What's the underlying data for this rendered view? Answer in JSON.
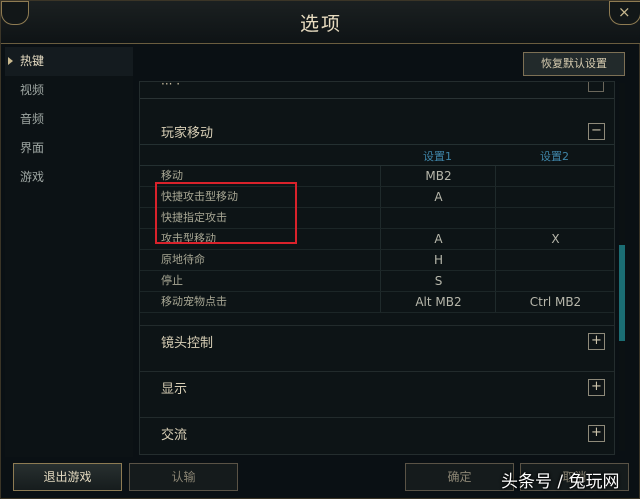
{
  "window": {
    "title": "选项",
    "close_glyph": "×"
  },
  "sidebar": {
    "items": [
      {
        "label": "热键",
        "active": true
      },
      {
        "label": "视频",
        "active": false
      },
      {
        "label": "音频",
        "active": false
      },
      {
        "label": "界面",
        "active": false
      },
      {
        "label": "游戏",
        "active": false
      }
    ]
  },
  "toolbar": {
    "restore_label": "恢复默认设置"
  },
  "sections": {
    "player_move": {
      "title": "玩家移动",
      "toggle": "−"
    },
    "camera": {
      "title": "镜头控制",
      "toggle": "+"
    },
    "display": {
      "title": "显示",
      "toggle": "+"
    },
    "chat": {
      "title": "交流",
      "toggle": "+"
    }
  },
  "grid": {
    "headers": {
      "setting1": "设置1",
      "setting2": "设置2"
    },
    "rows": [
      {
        "name": "移动",
        "b1": "MB2",
        "b2": ""
      },
      {
        "name": "快捷攻击型移动",
        "b1": "A",
        "b2": ""
      },
      {
        "name": "快捷指定攻击",
        "b1": "",
        "b2": ""
      },
      {
        "name": "攻击型移动",
        "b1": "A",
        "b2": "X"
      },
      {
        "name": "原地待命",
        "b1": "H",
        "b2": ""
      },
      {
        "name": "停止",
        "b1": "S",
        "b2": ""
      },
      {
        "name": "移动宠物点击",
        "b1": "Alt  MB2",
        "b2": "Ctrl  MB2"
      }
    ]
  },
  "footer": {
    "exit_label": "退出游戏",
    "confirm_label": "认输",
    "ok_label": "确定",
    "cancel_label": "取消"
  },
  "watermark": {
    "text": "头条号 / 兔玩网"
  },
  "colors": {
    "highlight_box": "#d9222b",
    "accent": "#3f85a8",
    "gold": "#c9b98f"
  }
}
